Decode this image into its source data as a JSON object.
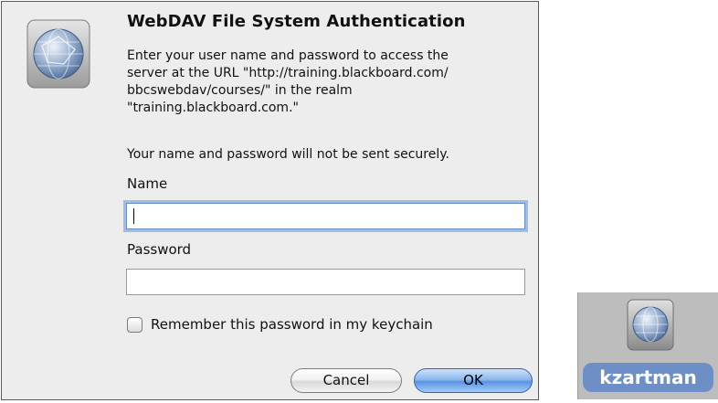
{
  "dialog": {
    "title": "WebDAV File System Authentication",
    "message": "Enter your user name and password to access the\nserver at the URL \"http://training.blackboard.com/\nbbcswebdav/courses/\" in the realm\n\"training.blackboard.com.\"",
    "warning": "Your name and password will not be sent securely.",
    "name_label": "Name",
    "name_value": "",
    "password_label": "Password",
    "password_value": "",
    "remember_label": "Remember this password in my keychain",
    "remember_checked": false,
    "cancel_label": "Cancel",
    "ok_label": "OK",
    "app_icon": "network-globe-icon"
  },
  "desktop": {
    "user_label": "kzartman",
    "user_icon": "network-drive-icon"
  },
  "colors": {
    "accent": "#5b94e2",
    "label_highlight": "#6d8fc6",
    "dialog_bg": "#ededed"
  }
}
